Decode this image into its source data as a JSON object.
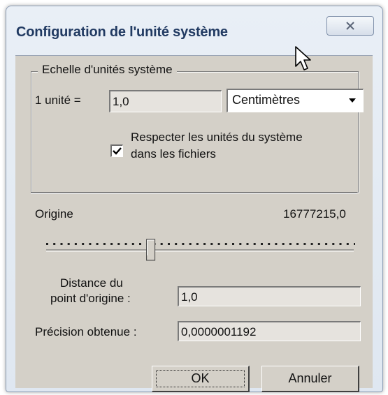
{
  "window": {
    "title": "Configuration de l'unité système"
  },
  "scale": {
    "group_title": "Echelle d'unités système",
    "unit_label": "1 unité =",
    "unit_value": "1,0",
    "unit_select": "Centimètres",
    "respect_checked": true,
    "respect_label_line1": "Respecter les unités du système",
    "respect_label_line2": "dans les fichiers"
  },
  "origin": {
    "label": "Origine",
    "value": "16777215,0",
    "slider_fraction": 0.34,
    "distance_label_line1": "Distance du",
    "distance_label_line2": "point d'origine :",
    "distance_value": "1,0",
    "precision_label": "Précision obtenue :",
    "precision_value": "0,0000001192"
  },
  "buttons": {
    "ok": "OK",
    "cancel": "Annuler"
  },
  "icons": {
    "close": "close-icon",
    "dropdown": "chevron-down-icon",
    "check": "check-icon",
    "cursor": "mouse-cursor-icon"
  }
}
